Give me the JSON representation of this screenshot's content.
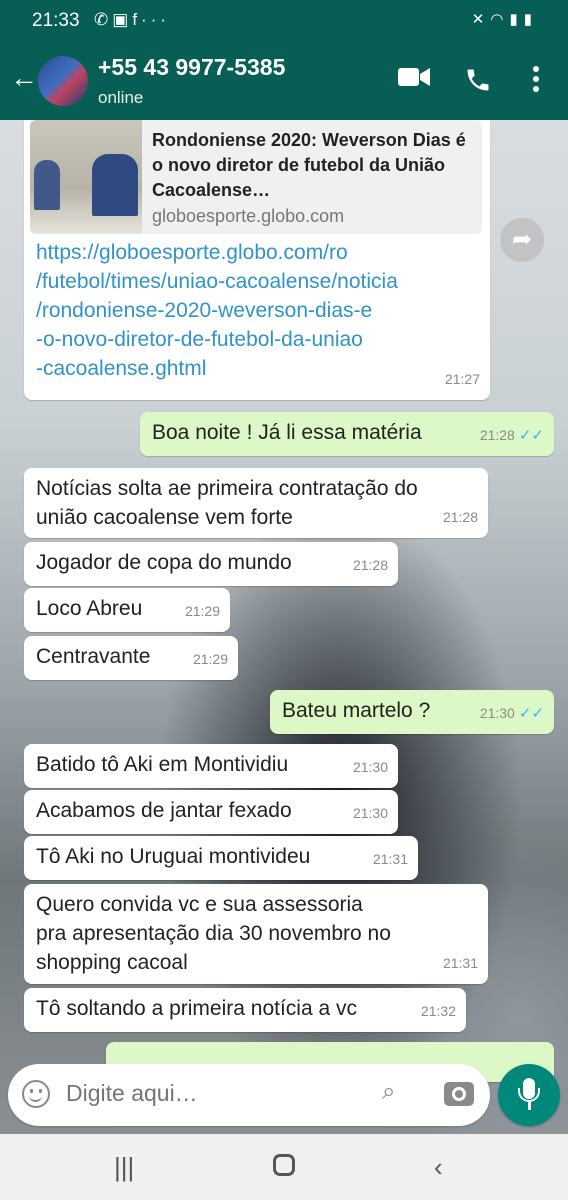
{
  "status_bar": {
    "time": "21:33",
    "app_icons": [
      "whatsapp-icon",
      "image-icon",
      "facebook-icon",
      "more-icon"
    ],
    "system_icons": [
      "mute-icon",
      "wifi-icon",
      "signal-icon",
      "battery-icon"
    ]
  },
  "header": {
    "contact": "+55 43 9977-5385",
    "presence": "online",
    "icons": [
      "back-arrow-icon",
      "video-call-icon",
      "phone-icon",
      "overflow-menu-icon"
    ]
  },
  "messages": [
    {
      "direction": "in",
      "link_preview": {
        "title": "Rondoniense 2020: Weverson Dias é o novo diretor de futebol da União Cacoalense…",
        "domain": "globoesporte.globo.com"
      },
      "text": "https://globoesporte.globo.com/ro/futebol/times/uniao-cacoalense/noticia/rondoniense-2020-weverson-dias-e-o-novo-diretor-de-futebol-da-uniao-cacoalense.ghtml",
      "lines": [
        "https://globoesporte.globo.com/ro",
        "/futebol/times/uniao-cacoalense/noticia",
        "/rondoniense-2020-weverson-dias-e",
        "-o-novo-diretor-de-futebol-da-uniao",
        "-cacoalense.ghtml"
      ],
      "time": "21:27"
    },
    {
      "direction": "out",
      "text": "Boa noite ! Já li essa matéria",
      "time": "21:28",
      "ticks": "✓✓"
    },
    {
      "direction": "in",
      "text": "Notícias solta ae primeira contratação do união cacoalense vem forte",
      "lines": [
        "Notícias solta ae primeira contratação do",
        "união cacoalense vem forte"
      ],
      "time": "21:28"
    },
    {
      "direction": "in",
      "text": "Jogador de copa do mundo",
      "time": "21:28"
    },
    {
      "direction": "in",
      "text": "Loco Abreu",
      "time": "21:29"
    },
    {
      "direction": "in",
      "text": "Centravante",
      "time": "21:29"
    },
    {
      "direction": "out",
      "text": "Bateu martelo ?",
      "time": "21:30",
      "ticks": "✓✓"
    },
    {
      "direction": "in",
      "text": "Batido tô Aki em Montividiu",
      "time": "21:30"
    },
    {
      "direction": "in",
      "text": "Acabamos de jantar fexado",
      "time": "21:30"
    },
    {
      "direction": "in",
      "text": "Tô Aki no Uruguai montivideu",
      "time": "21:31"
    },
    {
      "direction": "in",
      "text": "Quero convida vc e sua assessoria pra apresentação dia 30 novembro no shopping cacoal",
      "lines": [
        "Quero convida vc e sua assessoria",
        "pra apresentação dia 30 novembro no",
        "shopping cacoal"
      ],
      "time": "21:31"
    },
    {
      "direction": "in",
      "text": "Tô soltando a primeira notícia a vc",
      "time": "21:32"
    }
  ],
  "input": {
    "placeholder": "Digite aqui…",
    "icons": [
      "emoji-icon",
      "attach-icon",
      "camera-icon",
      "mic-icon"
    ]
  },
  "forward_icon": "forward-icon",
  "nav_bar": {
    "icons": [
      "recent-apps-icon",
      "home-icon",
      "back-icon"
    ]
  }
}
